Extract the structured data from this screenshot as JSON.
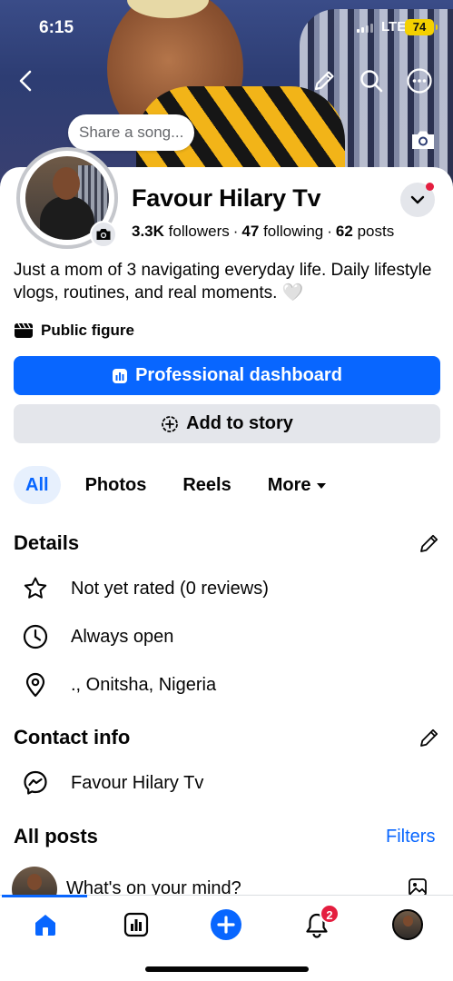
{
  "status_bar": {
    "time": "6:15",
    "network": "LTE",
    "battery": "74"
  },
  "cover": {
    "share_song_placeholder": "Share a song..."
  },
  "profile": {
    "name": "Favour Hilary Tv",
    "followers_count": "3.3K",
    "followers_label": "followers",
    "following_count": "47",
    "following_label": "following",
    "posts_count": "62",
    "posts_label": "posts",
    "bio": "Just a mom of 3 navigating everyday life. Daily lifestyle vlogs, routines, and real moments. 🤍",
    "category": "Public figure"
  },
  "actions": {
    "professional_dashboard": "Professional dashboard",
    "add_to_story": "Add to story"
  },
  "tabs": [
    {
      "label": "All",
      "active": true
    },
    {
      "label": "Photos",
      "active": false
    },
    {
      "label": "Reels",
      "active": false
    },
    {
      "label": "More",
      "active": false
    }
  ],
  "details": {
    "title": "Details",
    "items": [
      {
        "icon": "star-icon",
        "text": "Not yet rated (0 reviews)"
      },
      {
        "icon": "clock-icon",
        "text": "Always open"
      },
      {
        "icon": "location-pin-icon",
        "text": "., Onitsha, Nigeria"
      }
    ]
  },
  "contact": {
    "title": "Contact info",
    "items": [
      {
        "icon": "messenger-icon",
        "text": "Favour Hilary Tv"
      }
    ]
  },
  "posts": {
    "title": "All posts",
    "filters_label": "Filters",
    "composer_prompt": "What's on your mind?"
  },
  "tabbar": {
    "notifications_badge": "2"
  },
  "colors": {
    "accent": "#0866ff",
    "badge": "#e41e3f",
    "secondary_bg": "#e4e6eb"
  }
}
